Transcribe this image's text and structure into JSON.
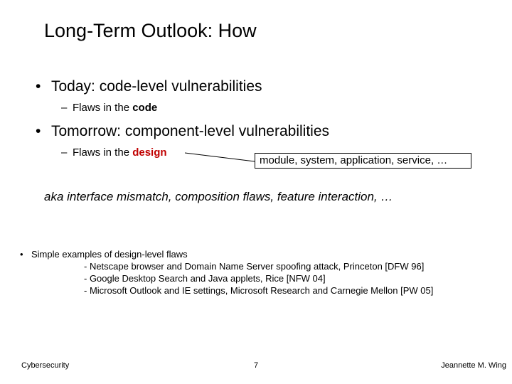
{
  "title": "Long-Term Outlook: How",
  "bullet1": {
    "text": "Today: code-level vulnerabilities",
    "sub_prefix": "Flaws in the ",
    "sub_strong": "code"
  },
  "bullet2": {
    "text": "Tomorrow: component-level vulnerabilities",
    "sub_prefix": "Flaws in the ",
    "sub_strong": "design"
  },
  "callout": "module, system, application, service, …",
  "aka": "aka interface mismatch, composition flaws, feature interaction, …",
  "examples": {
    "head": "Simple examples of design-level flaws",
    "line1": "- Netscape browser and Domain Name Server spoofing attack, Princeton [DFW 96]",
    "line2": "- Google Desktop Search and Java applets, Rice [NFW 04]",
    "line3": "- Microsoft Outlook and IE settings, Microsoft Research and Carnegie Mellon [PW 05]"
  },
  "footer": {
    "left": "Cybersecurity",
    "center": "7",
    "right": "Jeannette M. Wing"
  }
}
